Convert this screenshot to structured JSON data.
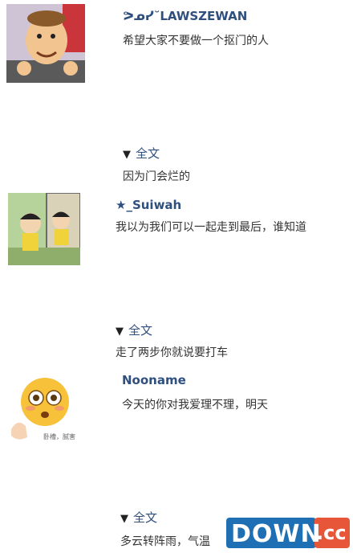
{
  "posts": [
    {
      "username": "ᕗᓄᓯ˘LAWSZEWAN",
      "text": "希望大家不要做一个抠门的人",
      "expand_label": "全文",
      "expanded_text": "因为门会烂的"
    },
    {
      "username": "★_Suiwah",
      "text": "我以为我们可以一起走到最后，谁知道",
      "expand_label": "全文",
      "expanded_text": "走了两步你就说要打车"
    },
    {
      "username": "Nooname",
      "text": "今天的你对我爱理不理，明天",
      "avatar_caption": "卧槽，腻害",
      "expand_label": "全文",
      "expanded_text": "多云转阵雨，气温"
    }
  ],
  "expand_icon": "triangle-down-icon",
  "watermark": {
    "text_main": "DOWN",
    "text_sub": ".cc",
    "color_main": "#1f6fb5",
    "color_sub": "#e8563a"
  }
}
